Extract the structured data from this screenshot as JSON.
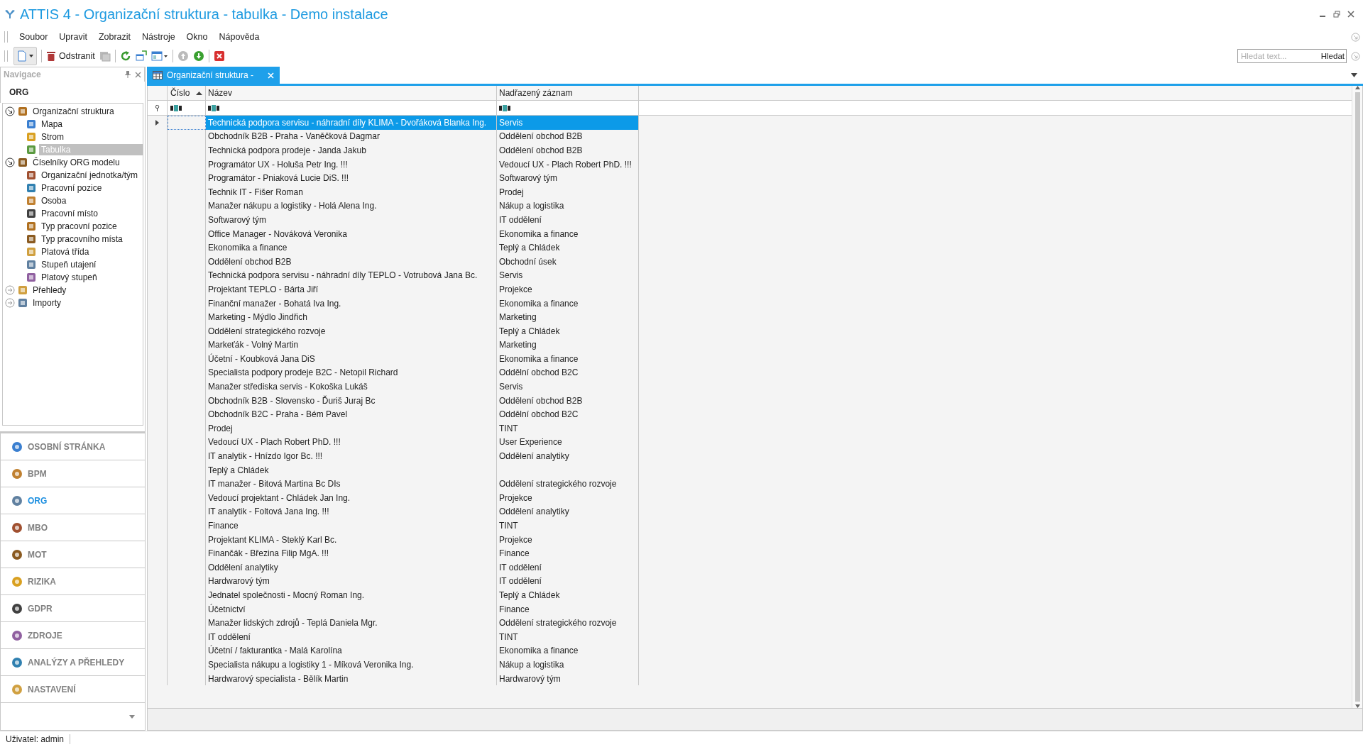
{
  "window": {
    "title": "ATTIS 4 - Organizační struktura - tabulka - Demo instalace"
  },
  "menu": [
    "Soubor",
    "Upravit",
    "Zobrazit",
    "Nástroje",
    "Okno",
    "Nápověda"
  ],
  "toolbar": {
    "delete_label": "Odstranit"
  },
  "search": {
    "placeholder": "Hledat text...",
    "button": "Hledat"
  },
  "navigation": {
    "title": "Navigace",
    "heading": "ORG",
    "tree": [
      {
        "label": "Organizační struktura",
        "expanded": true,
        "selected": false,
        "children": [
          {
            "label": "Mapa",
            "selected": false
          },
          {
            "label": "Strom",
            "selected": false
          },
          {
            "label": "Tabulka",
            "selected": true
          }
        ]
      },
      {
        "label": "Číselníky ORG modelu",
        "expanded": true,
        "selected": false,
        "children": [
          {
            "label": "Organizační jednotka/tým",
            "selected": false
          },
          {
            "label": "Pracovní pozice",
            "selected": false
          },
          {
            "label": "Osoba",
            "selected": false
          },
          {
            "label": "Pracovní místo",
            "selected": false
          },
          {
            "label": "Typ pracovní pozice",
            "selected": false
          },
          {
            "label": "Typ pracovního místa",
            "selected": false
          },
          {
            "label": "Platová třída",
            "selected": false
          },
          {
            "label": "Stupeň utajení",
            "selected": false
          },
          {
            "label": "Platový stupeň",
            "selected": false
          }
        ]
      },
      {
        "label": "Přehledy",
        "expanded": false,
        "selected": false
      },
      {
        "label": "Importy",
        "expanded": false,
        "selected": false
      }
    ]
  },
  "modules": [
    {
      "label": "OSOBNÍ STRÁNKA",
      "selected": false
    },
    {
      "label": "BPM",
      "selected": false
    },
    {
      "label": "ORG",
      "selected": true
    },
    {
      "label": "MBO",
      "selected": false
    },
    {
      "label": "MOT",
      "selected": false
    },
    {
      "label": "RIZIKA",
      "selected": false
    },
    {
      "label": "GDPR",
      "selected": false
    },
    {
      "label": "ZDROJE",
      "selected": false
    },
    {
      "label": "ANALÝZY A PŘEHLEDY",
      "selected": false
    },
    {
      "label": "NASTAVENÍ",
      "selected": false
    }
  ],
  "tab": {
    "label": "Organizační struktura -"
  },
  "table": {
    "columns": [
      {
        "label": "Číslo",
        "sorted": true
      },
      {
        "label": "Název",
        "sorted": false
      },
      {
        "label": "Nadřazený záznam",
        "sorted": false
      }
    ],
    "rows": [
      {
        "name": "Technická podpora servisu - náhradní díly KLIMA - Dvořáková Blanka Ing.",
        "parent": "Servis",
        "selected": true
      },
      {
        "name": "Obchodník B2B - Praha - Vaněčková Dagmar",
        "parent": "Oddělení obchod B2B",
        "selected": false
      },
      {
        "name": "Technická podpora prodeje - Janda Jakub",
        "parent": "Oddělení obchod B2B",
        "selected": false
      },
      {
        "name": "Programátor UX - Holuša Petr Ing. !!!",
        "parent": "Vedoucí UX - Plach Robert PhD. !!!",
        "selected": false
      },
      {
        "name": "Programátor - Pniaková Lucie DiS. !!!",
        "parent": "Softwarový tým",
        "selected": false
      },
      {
        "name": "Technik IT - Fišer Roman",
        "parent": "Prodej",
        "selected": false
      },
      {
        "name": "Manažer nákupu a logistiky - Holá Alena Ing.",
        "parent": "Nákup a logistika",
        "selected": false
      },
      {
        "name": "Softwarový tým",
        "parent": "IT oddělení",
        "selected": false
      },
      {
        "name": "Office Manager - Nováková Veronika",
        "parent": "Ekonomika a finance",
        "selected": false
      },
      {
        "name": "Ekonomika a finance",
        "parent": "Teplý a Chládek",
        "selected": false
      },
      {
        "name": "Oddělení obchod B2B",
        "parent": "Obchodní úsek",
        "selected": false
      },
      {
        "name": "Technická podpora servisu - náhradní díly TEPLO - Votrubová Jana Bc.",
        "parent": "Servis",
        "selected": false
      },
      {
        "name": "Projektant TEPLO - Bárta Jiří",
        "parent": "Projekce",
        "selected": false
      },
      {
        "name": "Finanční manažer - Bohatá Iva Ing.",
        "parent": "Ekonomika a finance",
        "selected": false
      },
      {
        "name": "Marketing - Mýdlo Jindřich",
        "parent": "Marketing",
        "selected": false
      },
      {
        "name": "Oddělení strategického rozvoje",
        "parent": "Teplý a Chládek",
        "selected": false
      },
      {
        "name": "Markeťák - Volný Martin",
        "parent": "Marketing",
        "selected": false
      },
      {
        "name": "Účetní - Koubková Jana DiS",
        "parent": "Ekonomika a finance",
        "selected": false
      },
      {
        "name": "Specialista podpory prodeje B2C - Netopil Richard",
        "parent": "Oddělní obchod B2C",
        "selected": false
      },
      {
        "name": "Manažer střediska servis - Kokoška Lukáš",
        "parent": "Servis",
        "selected": false
      },
      {
        "name": "Obchodník B2B - Slovensko - Ďuriš Juraj Bc",
        "parent": "Oddělení obchod B2B",
        "selected": false
      },
      {
        "name": "Obchodník B2C - Praha - Bém Pavel",
        "parent": "Oddělní obchod B2C",
        "selected": false
      },
      {
        "name": "Prodej",
        "parent": "TINT",
        "selected": false
      },
      {
        "name": "Vedoucí UX - Plach Robert PhD. !!!",
        "parent": "User Experience",
        "selected": false
      },
      {
        "name": "IT analytik - Hnízdo Igor Bc. !!!",
        "parent": "Oddělení analytiky",
        "selected": false
      },
      {
        "name": "Teplý a Chládek",
        "selected": false
      },
      {
        "name": "IT manažer - Bitová Martina Bc DIs",
        "parent": "Oddělení strategického rozvoje",
        "selected": false
      },
      {
        "name": "Vedoucí projektant - Chládek Jan Ing.",
        "parent": "Projekce",
        "selected": false
      },
      {
        "name": "IT analytik - Foltová Jana Ing. !!!",
        "parent": "Oddělení analytiky",
        "selected": false
      },
      {
        "name": "Finance",
        "parent": "TINT",
        "selected": false
      },
      {
        "name": "Projektant KLIMA - Steklý Karl Bc.",
        "parent": "Projekce",
        "selected": false
      },
      {
        "name": "Finančák - Březina Filip MgA. !!!",
        "parent": "Finance",
        "selected": false
      },
      {
        "name": "Oddělení analytiky",
        "parent": "IT oddělení",
        "selected": false
      },
      {
        "name": "Hardwarový tým",
        "parent": "IT oddělení",
        "selected": false
      },
      {
        "name": "Jednatel společnosti - Mocný Roman Ing.",
        "parent": "Teplý a Chládek",
        "selected": false
      },
      {
        "name": "Účetnictví",
        "parent": "Finance",
        "selected": false
      },
      {
        "name": "Manažer lidských zdrojů - Teplá Daniela Mgr.",
        "parent": "Oddělení strategického rozvoje",
        "selected": false
      },
      {
        "name": "IT oddělení",
        "parent": "TINT",
        "selected": false
      },
      {
        "name": "Účetní / fakturantka - Malá Karolína",
        "parent": "Ekonomika a finance",
        "selected": false
      },
      {
        "name": "Specialista nákupu a logistiky 1 - Míková Veronika Ing.",
        "parent": "Nákup a logistika",
        "selected": false
      },
      {
        "name": "Hardwarový specialista - Bělík Martin",
        "parent": "Hardwarový tým",
        "selected": false
      }
    ]
  },
  "status_bar": "Uživatel: admin"
}
